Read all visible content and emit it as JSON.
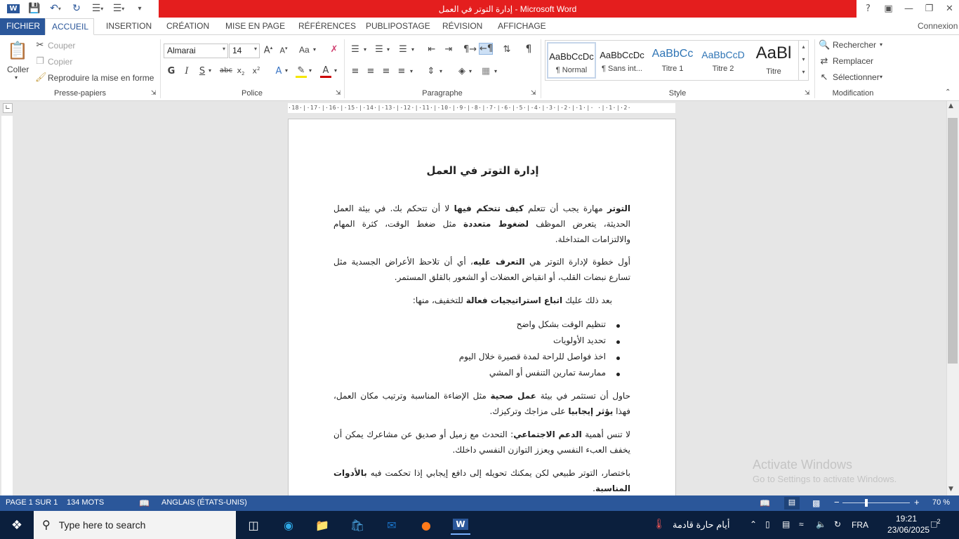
{
  "window": {
    "title": "إدارة التوتر في العمل  -  Microsoft Word",
    "help": "?",
    "connexion": "Connexion"
  },
  "tabs": [
    "FICHIER",
    "ACCUEIL",
    "INSERTION",
    "CRÉATION",
    "MISE EN PAGE",
    "RÉFÉRENCES",
    "PUBLIPOSTAGE",
    "RÉVISION",
    "AFFICHAGE"
  ],
  "ribbon": {
    "clipboard": {
      "paste": "Coller",
      "cut": "Couper",
      "copy": "Copier",
      "format_painter": "Reproduire la mise en forme",
      "label": "Presse-papiers"
    },
    "font": {
      "name": "Almarai",
      "size": "14",
      "label": "Police",
      "aa": "Aa"
    },
    "paragraph": {
      "label": "Paragraphe"
    },
    "styles": {
      "label": "Style",
      "items": [
        {
          "preview": "AaBbCcDc",
          "name": "¶ Normal"
        },
        {
          "preview": "AaBbCcDc",
          "name": "¶ Sans int..."
        },
        {
          "preview": "AaBbCc",
          "name": "Titre 1"
        },
        {
          "preview": "AaBbCcD",
          "name": "Titre 2"
        },
        {
          "preview": "AaBl",
          "name": "Titre"
        }
      ]
    },
    "editing": {
      "find": "Rechercher",
      "replace": "Remplacer",
      "select": "Sélectionner",
      "label": "Modification"
    }
  },
  "ruler": {
    "text": "·18·|·17·|·16·|·15·|·14·|·13·|·12·|·11·|·10·|·9·|·8·|·7·|·6·|·5·|·4·|·3·|·2·|·1·|·  ·|·1·|·2·"
  },
  "document": {
    "title": "إدارة التوتر في العمل",
    "p1": {
      "a": "التوتر",
      "b": " مهارة يجب أن تتعلم ",
      "c": "كيف تتحكم فيها",
      "d": " لا أن تتحكم بك. في بيئة العمل الحديثة، يتعرض الموظف ",
      "e": "لضغوط متعددة",
      "f": " مثل ضغط الوقت، كثرة المهام والالتزامات المتداخلة."
    },
    "p2": {
      "a": "أول خطوة لإدارة التوتر هي ",
      "b": "التعرف عليه",
      "c": "، أي أن تلاحظ الأعراض الجسدية مثل تسارع نبضات القلب، أو انقباض العضلات أو الشعور بالقلق المستمر."
    },
    "p3": {
      "a": "بعد ذلك عليك ",
      "b": "اتباع استراتيجيات فعالة",
      "c": " للتخفيف، منها:"
    },
    "bullets": [
      "تنظيم الوقت بشكل واضح",
      "تحديد الأولويات",
      "اخذ فواصل للراحة لمدة قصيرة خلال اليوم",
      "ممارسة تمارين التنفس أو المشي"
    ],
    "p4": {
      "a": "حاول أن تستثمر في بيئة ",
      "b": "عمل صحية",
      "c": " مثل الإضاءة المناسبة وترتيب مكان العمل، فهذا ",
      "d": "يؤثر إيجابيا",
      "e": " على مزاجك وتركيزك."
    },
    "p5": {
      "a": "لا تنس أهمية ",
      "b": "الدعم الاجتماعي",
      "c": ": التحدث مع زميل أو صديق عن مشاعرك يمكن أن يخفف العبء النفسي ويعزز التوازن النفسي داخلك."
    },
    "p6": {
      "a": "باختصار، التوتر طبيعي لكن يمكنك تحويله إلى دافع إيجابي إذا تحكمت فيه ",
      "b": "بالأدوات المناسبة",
      "c": "."
    }
  },
  "watermark": {
    "line1": "Activate Windows",
    "line2": "Go to Settings to activate Windows."
  },
  "status": {
    "page": "PAGE 1 SUR 1",
    "words": "134 MOTS",
    "language": "ANGLAIS (ÉTATS-UNIS)",
    "zoom": "70 %"
  },
  "taskbar": {
    "search_placeholder": "Type here to search",
    "weather": "أيام حارة قادمة",
    "lang": "FRA",
    "time": "19:21",
    "date": "23/06/2025",
    "notifications": "2"
  }
}
